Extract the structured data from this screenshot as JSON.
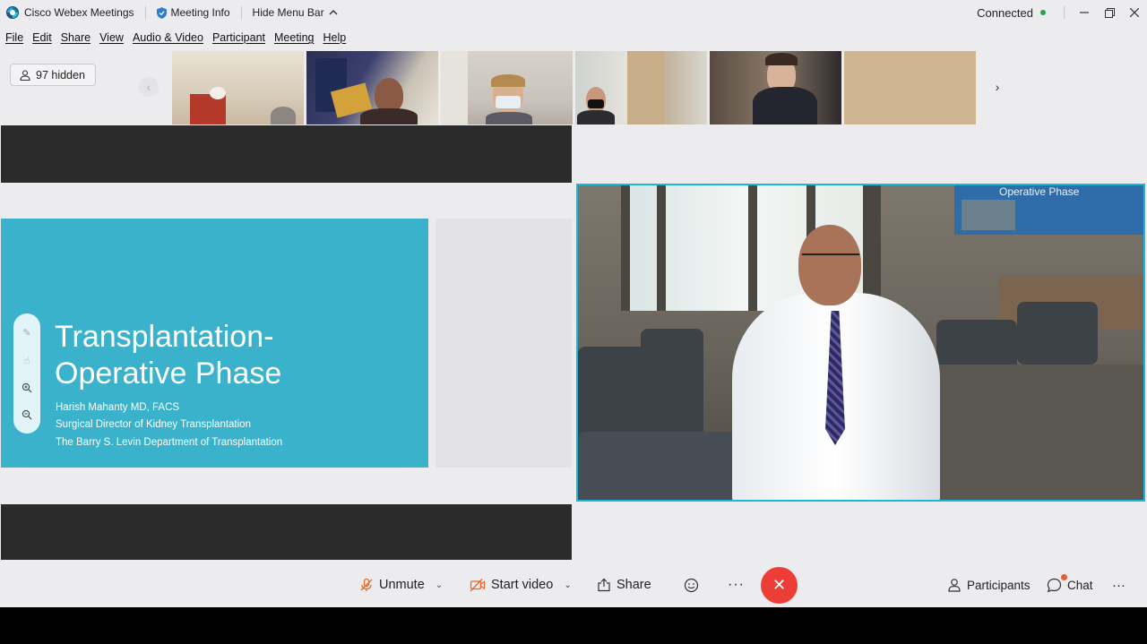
{
  "titlebar": {
    "app_name": "Cisco Webex Meetings",
    "meeting_info": "Meeting Info",
    "hide_menu": "Hide Menu Bar",
    "status": "Connected",
    "status_color": "#2aa14a"
  },
  "menubar": {
    "items": [
      "File",
      "Edit",
      "Share",
      "View",
      "Audio & Video",
      "Participant",
      "Meeting",
      "Help"
    ]
  },
  "filmstrip": {
    "hidden_label": "97 hidden"
  },
  "slide": {
    "title_line1": "Transplantation-",
    "title_line2": "Operative Phase",
    "presenter": "Harish Mahanty MD, FACS",
    "role": "Surgical Director of Kidney Transplantation",
    "department": "The Barry S. Levin Department of Transplantation",
    "background_color": "#3bb2cc"
  },
  "speaker_video": {
    "screen_text": "Operative Phase",
    "border_color": "#1ab8d6"
  },
  "controls": {
    "unmute": "Unmute",
    "start_video": "Start video",
    "share": "Share",
    "participants": "Participants",
    "chat": "Chat",
    "end_color": "#ec3e37"
  }
}
